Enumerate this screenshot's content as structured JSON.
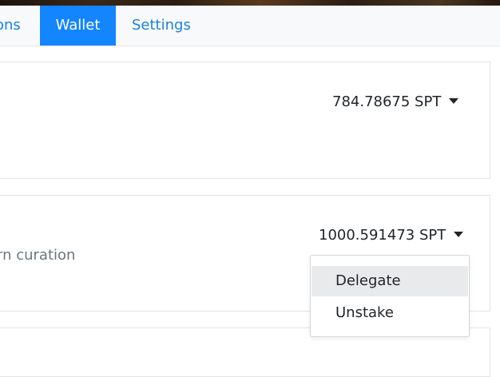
{
  "tabs": [
    {
      "label": "ons",
      "active": false
    },
    {
      "label": "Wallet",
      "active": true
    },
    {
      "label": "Settings",
      "active": false
    }
  ],
  "cards": [
    {
      "amount": "784.78675 SPT"
    },
    {
      "amount": "1000.591473 SPT",
      "description": "rn curation"
    }
  ],
  "dropdown": {
    "items": [
      "Delegate",
      "Unstake"
    ],
    "highlighted": "Delegate"
  },
  "colors": {
    "accent": "#1385ff",
    "link": "#1a82e2",
    "hover": "#e9eaec"
  }
}
